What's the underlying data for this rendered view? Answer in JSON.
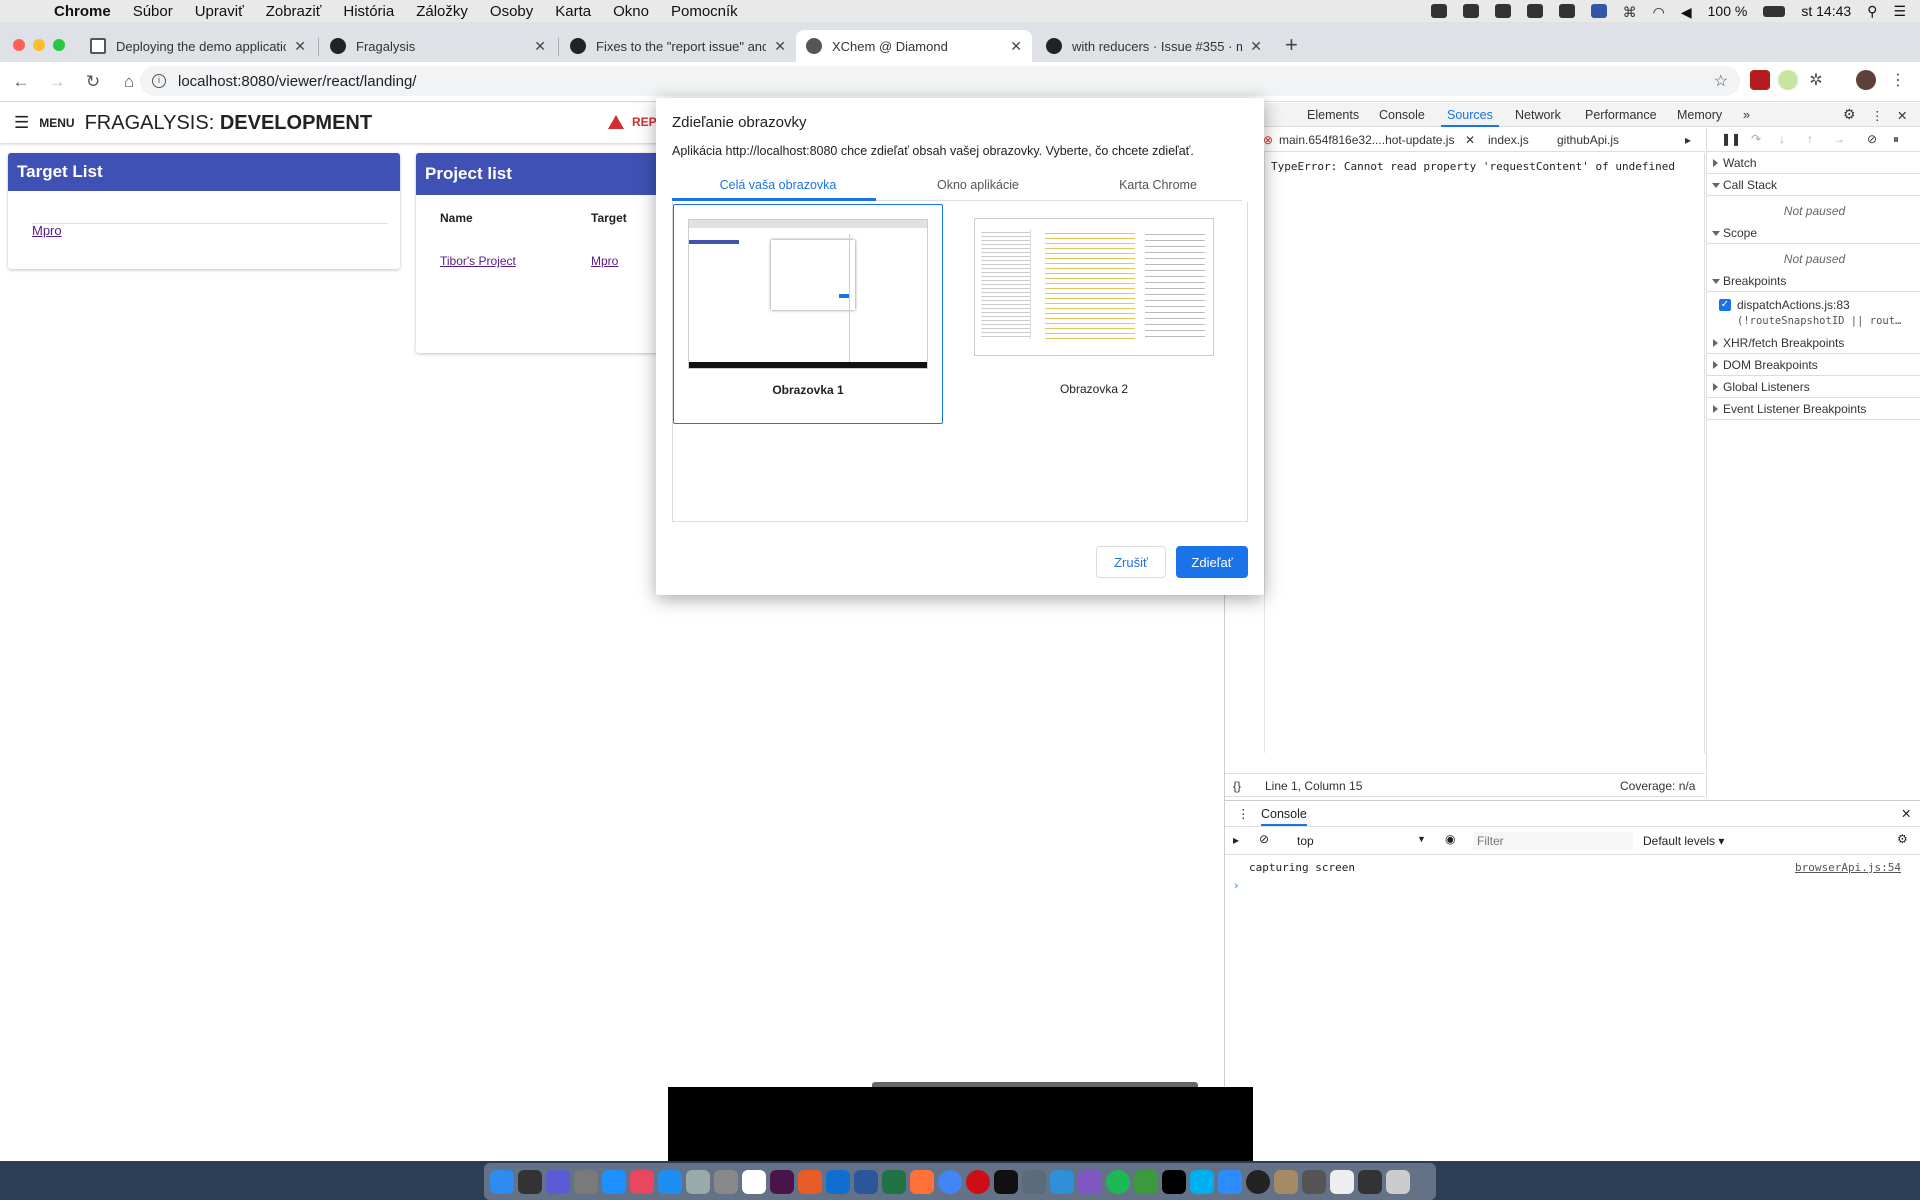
{
  "menubar": {
    "app": "Chrome",
    "items": [
      "Súbor",
      "Upraviť",
      "Zobraziť",
      "História",
      "Záložky",
      "Osoby",
      "Karta",
      "Okno",
      "Pomocník"
    ],
    "battery": "100 %",
    "clock": "st 14:43"
  },
  "tabs": [
    {
      "title": "Deploying the demo applicatio",
      "icon": "document-icon"
    },
    {
      "title": "Fragalysis",
      "icon": "github-icon"
    },
    {
      "title": "Fixes to the \"report issue\" and",
      "icon": "github-icon"
    },
    {
      "title": "XChem @ Diamond",
      "icon": "globe-icon",
      "active": true
    },
    {
      "title": "with reducers · Issue #355 · m",
      "icon": "github-icon"
    }
  ],
  "address": {
    "url": "localhost:8080/viewer/react/landing/"
  },
  "app": {
    "menu_label": "MENU",
    "title_prefix": "FRAGALYSIS: ",
    "title_strong": "DEVELOPMENT",
    "report_label": "REPO"
  },
  "target_list": {
    "title": "Target List",
    "items": [
      "Mpro"
    ]
  },
  "project_list": {
    "title": "Project list",
    "columns": [
      "Name",
      "Target"
    ],
    "rows": [
      {
        "name": "Tibor's Project",
        "target": "Mpro"
      }
    ]
  },
  "dialog": {
    "title": "Zdieľanie obrazovky",
    "description": "Aplikácia http://localhost:8080 chce zdieľať obsah vašej obrazovky. Vyberte, čo chcete zdieľať.",
    "tabs": [
      "Celá vaša obrazovka",
      "Okno aplikácie",
      "Karta Chrome"
    ],
    "screens": [
      "Obrazovka 1",
      "Obrazovka 2"
    ],
    "cancel": "Zrušiť",
    "share": "Zdieľať"
  },
  "devtools": {
    "tabs": [
      "Elements",
      "Console",
      "Sources",
      "Network",
      "Performance",
      "Memory"
    ],
    "source_tabs": [
      "main.654f816e32....hot-update.js",
      "index.js",
      "githubApi.js"
    ],
    "code_line": "TypeError: Cannot read property 'requestContent' of undefined",
    "status_position": "Line 1, Column 15",
    "coverage": "Coverage: n/a",
    "debugger": {
      "watch": "Watch",
      "call_stack": "Call Stack",
      "not_paused": "Not paused",
      "scope": "Scope",
      "breakpoints": "Breakpoints",
      "breakpoint_file": "dispatchActions.js:83",
      "breakpoint_code": "(!routeSnapshotID || rout…",
      "xhr": "XHR/fetch Breakpoints",
      "dom": "DOM Breakpoints",
      "global": "Global Listeners",
      "event": "Event Listener Breakpoints"
    },
    "console": {
      "title": "Console",
      "context": "top",
      "filter_placeholder": "Filter",
      "levels": "Default levels ▾",
      "log_text": "capturing screen",
      "log_source": "browserApi.js:54"
    }
  },
  "colors": {
    "accent": "#3f51b5",
    "chrome_blue": "#1a73e8",
    "report_red": "#d32f2f"
  }
}
